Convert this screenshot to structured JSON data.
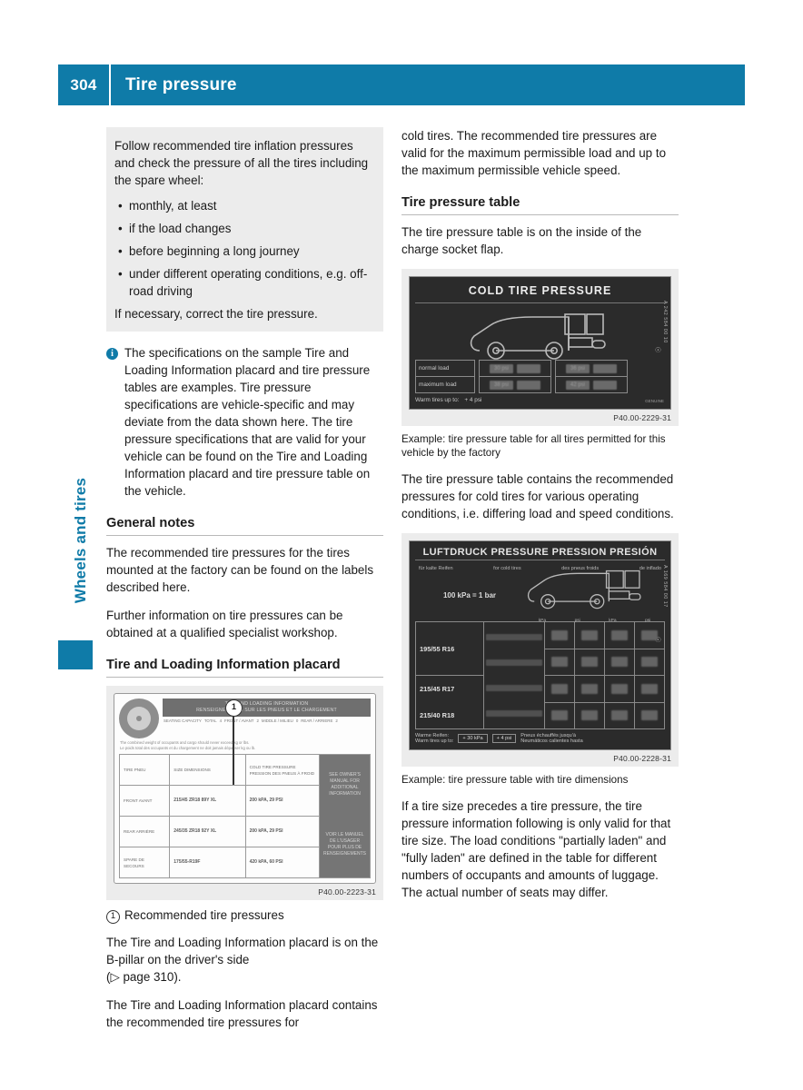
{
  "header": {
    "page_number": "304",
    "title": "Tire pressure",
    "accent_color": "#0f7ba8"
  },
  "side_tab": {
    "label": "Wheels and tires"
  },
  "left_column": {
    "grey_box": {
      "intro": "Follow recommended tire inflation pressures and check the pressure of all the tires including the spare wheel:",
      "bullets": [
        "monthly, at least",
        "if the load changes",
        "before beginning a long journey",
        "under different operating conditions, e.g. off-road driving"
      ],
      "outro": "If necessary, correct the tire pressure."
    },
    "info_note": {
      "icon": "info-icon",
      "text": "The specifications on the sample Tire and Loading Information placard and tire pressure tables are examples. Tire pressure specifications are vehicle-specific and may deviate from the data shown here. The tire pressure specifications that are valid for your vehicle can be found on the Tire and Loading Information placard and tire pressure table on the vehicle."
    },
    "general_notes": {
      "heading": "General notes",
      "paragraph_1": "The recommended tire pressures for the tires mounted at the factory can be found on the labels described here.",
      "paragraph_2": "Further information on tire pressures can be obtained at a qualified specialist workshop."
    },
    "placard_section": {
      "heading": "Tire and Loading Information placard",
      "figure": {
        "code": "P40.00-2223-31",
        "callout": "1",
        "band_line_1": "TIRE AND LOADING INFORMATION",
        "band_line_2": "RENSEIGNEMENTS SUR LES PNEUS ET LE CHARGEMENT",
        "seating_label_1": "SEATING CAPACITY",
        "seating_label_2": "NOMBRE DE PLACES",
        "seating_total": "TOTAL",
        "seating_total_value": "4",
        "seating_front": "FRONT / AVANT",
        "seating_front_value": "2",
        "seating_middle": "MIDDLE / MILIEU",
        "seating_middle_value": "0",
        "seating_rear": "REAR / ARRIERE",
        "seating_rear_value": "2",
        "disclaimer_1": "The combined weight of occupants and cargo should never exceed       kg or       lbs.",
        "disclaimer_2": "Le poids total des occupants et du chargement ne doit jamais dépasser       kg ou       lb.",
        "table": {
          "headers": [
            "TIRE\nPNEU",
            "SIZE\nDIMENSIONS",
            "COLD TIRE PRESSURE\nPRESSION DES\nPNEUS À FROID"
          ],
          "rows": [
            {
              "label": "FRONT\nAVANT",
              "size": "215/45 ZR18 89Y XL",
              "pressure": "200 kPA, 29 PSI"
            },
            {
              "label": "REAR\nARRIÈRE",
              "size": "245/35 ZR18 92Y XL",
              "pressure": "200 kPA, 29 PSI"
            },
            {
              "label": "SPARE\nDE SECOURS",
              "size": "175/55-R19F",
              "pressure": "420 kPA, 60 PSI"
            }
          ],
          "side_panel_en": "SEE OWNER'S MANUAL FOR ADDITIONAL INFORMATION",
          "side_panel_fr": "VOIR LE MANUEL DE L'USAGER POUR PLUS DE RENSEIGNEMENTS"
        }
      },
      "caption_number": "1",
      "caption": "Recommended tire pressures",
      "paragraph_1": "The Tire and Loading Information placard is on the B-pillar on the driver's side",
      "cross_reference": "(▷ page 310).",
      "paragraph_2": "The Tire and Loading Information placard contains the recommended tire pressures for"
    }
  },
  "right_column": {
    "continued_paragraph": "cold tires. The recommended tire pressures are valid for the maximum permissible load and up to the maximum permissible vehicle speed.",
    "table_section": {
      "heading": "Tire pressure table",
      "paragraph": "The tire pressure table is on the inside of the charge socket flap."
    },
    "figure_1": {
      "code": "P40.00-2229-31",
      "title": "COLD TIRE PRESSURE",
      "row_labels": [
        "normal load",
        "maximum load"
      ],
      "values": [
        [
          "30 psi",
          "36 psi"
        ],
        [
          "38 psi",
          "42 psi"
        ]
      ],
      "footer_label": "Warm tires up to:",
      "footer_value": "+ 4 psi",
      "side_code": "A 242 584 00 10",
      "corner_text": "GENUINE",
      "caption": "Example: tire pressure table for all tires permitted for this vehicle by the factory"
    },
    "paragraph_after_figure_1": "The tire pressure table contains the recommended pressures for cold tires for various operating conditions, i.e. differing load and speed conditions.",
    "figure_2": {
      "code": "P40.00-2228-31",
      "title": "LUFTDRUCK PRESSURE PRESSION PRESIÓN",
      "subtitles": [
        "für kalte Reifen",
        "for cold tires",
        "des pneus froids",
        "de inflado"
      ],
      "conversion": "100 kPa = 1 bar",
      "tire_sizes": [
        "195/55 R16",
        "215/45 R17",
        "215/40 R18"
      ],
      "unit_headers": [
        "kPa",
        "psi",
        "kPa",
        "psi"
      ],
      "footer_de": "Warme Reifen:",
      "footer_en": "Warm tires up to:",
      "footer_box_1": "+ 30 kPa",
      "footer_box_2": "+ 4 psi",
      "footer_fr": "Pneus échauffés jusqu'à",
      "footer_es": "Neumáticos calientes hasta",
      "side_code": "A 169 584 00 17",
      "caption": "Example: tire pressure table with tire dimensions"
    },
    "final_paragraph": "If a tire size precedes a tire pressure, the tire pressure information following is only valid for that tire size. The load conditions \"partially laden\" and \"fully laden\" are defined in the table for different numbers of occupants and amounts of luggage. The actual number of seats may differ."
  }
}
